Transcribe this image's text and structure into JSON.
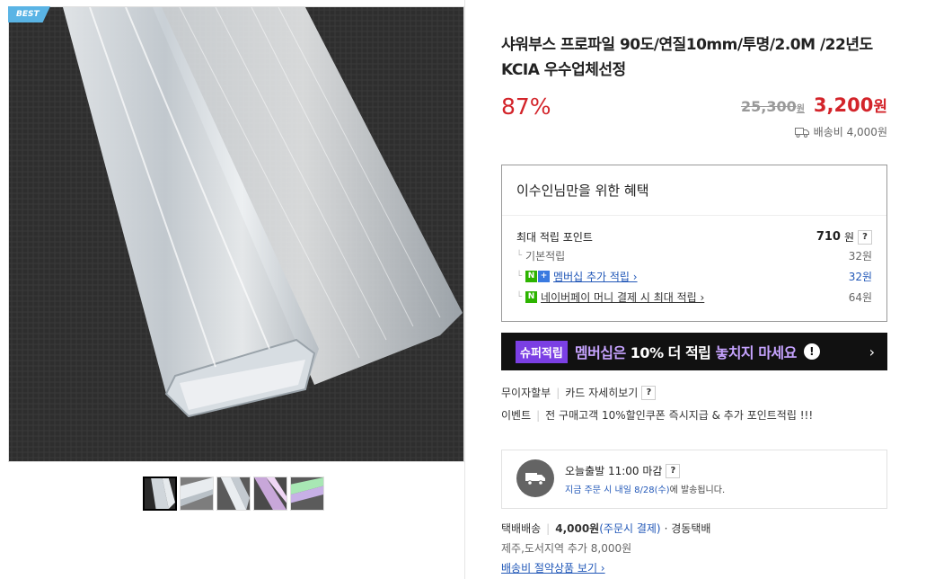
{
  "image": {
    "badge": "BEST",
    "thumbnail_count": 5
  },
  "product": {
    "title": "샤워부스 프로파일 90도/연질10mm/투명/2.0M /22년도 KCIA 우수업체선정",
    "discount": "87%",
    "original_price": "25,300",
    "original_price_unit": "원",
    "sale_price": "3,200",
    "sale_price_unit": "원",
    "shipping_fee_label": "배송비 4,000원"
  },
  "benefits": {
    "title": "이수인님만을 위한 혜택",
    "max_points_label": "최대 적립 포인트",
    "max_points_value": "710",
    "max_points_unit": "원",
    "help": "?",
    "rows": [
      {
        "label": "기본적립",
        "value": "32원"
      },
      {
        "label": "멤버십 추가 적립 ›",
        "value": "32원",
        "badge": "N+"
      },
      {
        "label": "네이버페이 머니 결제 시 최대 적립 ›",
        "value": "64원",
        "badge": "N"
      }
    ]
  },
  "banner": {
    "tag": "슈퍼적립",
    "text_prefix": "멤버십은 ",
    "text_bold": "10% 더 적립",
    "text_suffix": " 놓치지 마세요",
    "alert": "!",
    "arrow": "›"
  },
  "payment": {
    "interest_free": "무이자할부",
    "card_detail": "카드 자세히보기",
    "help": "?",
    "event_label": "이벤트",
    "event_text": "전 구매고객 10%할인쿠폰 즉시지급 & 추가 포인트적립 !!!"
  },
  "delivery": {
    "title": "오늘출발 11:00 마감",
    "help": "?",
    "sub_blue": "지금 주문 시 내일 8/28(수)",
    "sub_rest": "에 발송됩니다."
  },
  "shipping": {
    "method": "택배배송",
    "fee": "4,000원",
    "fee_note": "(주문시 결제)",
    "carrier": "· 경동택배",
    "extra": "제주,도서지역 추가 8,000원",
    "saving_link": "배송비 절약상품 보기 ›"
  },
  "colors": {
    "accent_red": "#d3242a",
    "link_blue": "#2258b8",
    "naver_green": "#2db400",
    "super_purple": "#7b3fe4"
  }
}
